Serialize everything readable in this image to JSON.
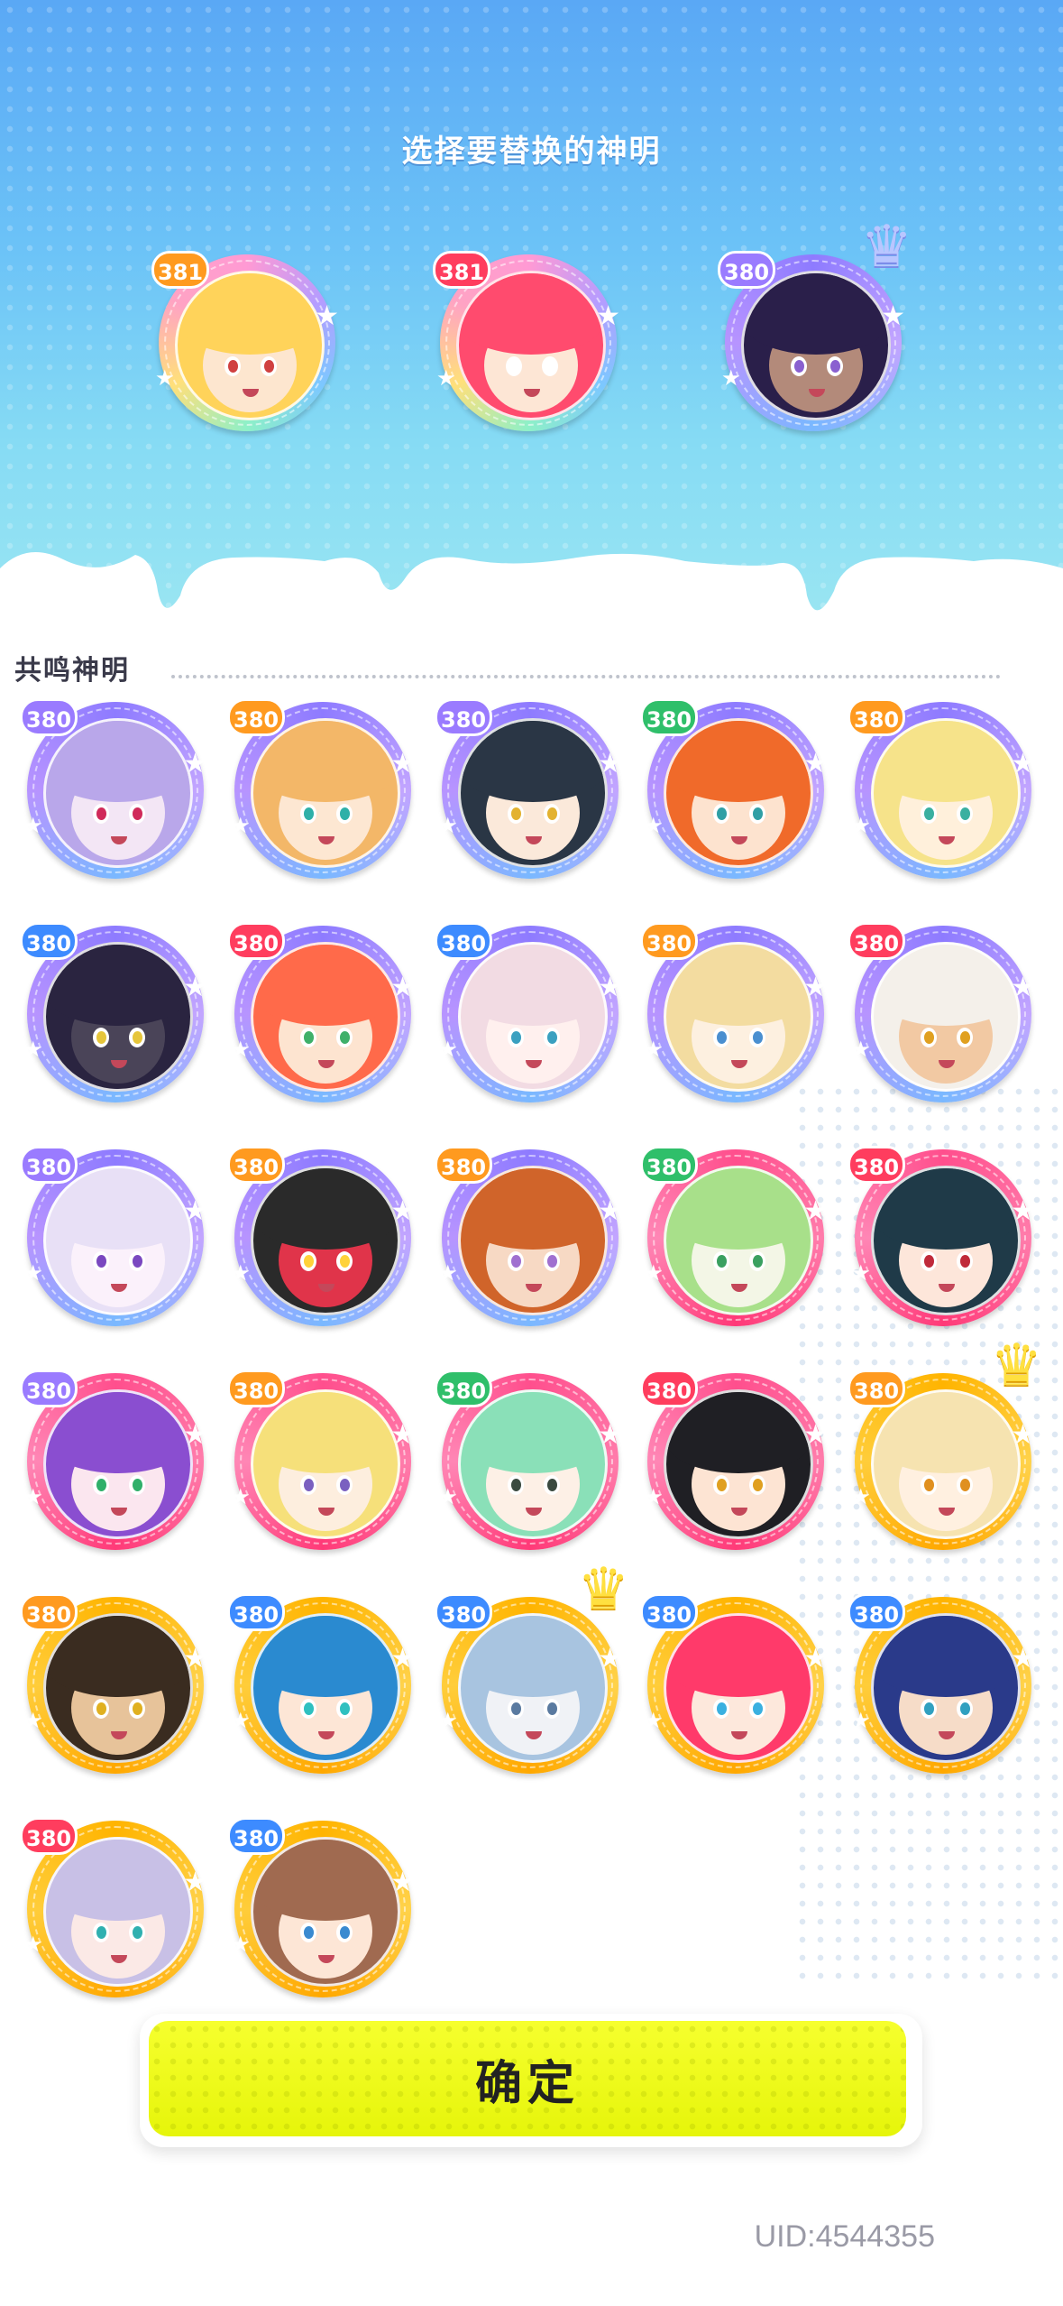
{
  "header": {
    "title": "选择要替换的神明"
  },
  "section": {
    "title": "共鸣神明"
  },
  "selected": [
    {
      "level": "381",
      "tier": "rainbow",
      "lvl_color": "orange",
      "hair": "#ffd35a",
      "skin": "#fde6cf",
      "iris": "#d04040",
      "crown": ""
    },
    {
      "level": "381",
      "tier": "rainbow",
      "lvl_color": "red",
      "hair": "#ff4b6e",
      "skin": "#fde6d5",
      "iris": "#ffffff",
      "crown": ""
    },
    {
      "level": "380",
      "tier": "purple",
      "lvl_color": "purple",
      "hair": "#2a1f4a",
      "skin": "#b38a7a",
      "iris": "#8a60d0",
      "crown": "ice"
    }
  ],
  "gods": [
    {
      "level": "380",
      "tier": "purple",
      "lvl_color": "purple",
      "hair": "#b9a7ea",
      "skin": "#f3e6f5",
      "iris": "#d02a5a",
      "crown": ""
    },
    {
      "level": "380",
      "tier": "purple",
      "lvl_color": "orange",
      "hair": "#f3b768",
      "skin": "#fde7d2",
      "iris": "#2fb0a8",
      "crown": ""
    },
    {
      "level": "380",
      "tier": "purple",
      "lvl_color": "purple",
      "hair": "#2a3645",
      "skin": "#fbe9da",
      "iris": "#e3b230",
      "crown": ""
    },
    {
      "level": "380",
      "tier": "purple",
      "lvl_color": "green",
      "hair": "#f06a2a",
      "skin": "#fde3cf",
      "iris": "#2f9fa5",
      "crown": ""
    },
    {
      "level": "380",
      "tier": "purple",
      "lvl_color": "orange",
      "hair": "#f6e38a",
      "skin": "#fff0db",
      "iris": "#3ab0a0",
      "crown": ""
    },
    {
      "level": "380",
      "tier": "purple",
      "lvl_color": "blue",
      "hair": "#2a2440",
      "skin": "#4a4458",
      "iris": "#e6c53a",
      "crown": ""
    },
    {
      "level": "380",
      "tier": "purple",
      "lvl_color": "red",
      "hair": "#ff6a4a",
      "skin": "#fde4d0",
      "iris": "#3fb06a",
      "crown": ""
    },
    {
      "level": "380",
      "tier": "purple",
      "lvl_color": "blue",
      "hair": "#f2dbe3",
      "skin": "#fff0ee",
      "iris": "#3aa0c0",
      "crown": ""
    },
    {
      "level": "380",
      "tier": "purple",
      "lvl_color": "orange",
      "hair": "#f3dca0",
      "skin": "#fdf0e0",
      "iris": "#4a8fd0",
      "crown": ""
    },
    {
      "level": "380",
      "tier": "purple",
      "lvl_color": "red",
      "hair": "#f4f0ea",
      "skin": "#f2c9a3",
      "iris": "#e0a020",
      "crown": ""
    },
    {
      "level": "380",
      "tier": "purple",
      "lvl_color": "purple",
      "hair": "#e8e0f6",
      "skin": "#fbf1fb",
      "iris": "#7a48c0",
      "crown": ""
    },
    {
      "level": "380",
      "tier": "purple",
      "lvl_color": "orange",
      "hair": "#2a2a2a",
      "skin": "#e0344a",
      "iris": "#ffd23a",
      "crown": ""
    },
    {
      "level": "380",
      "tier": "purple",
      "lvl_color": "orange",
      "hair": "#d0642a",
      "skin": "#f7d9c4",
      "iris": "#a070d0",
      "crown": ""
    },
    {
      "level": "380",
      "tier": "pink",
      "lvl_color": "green",
      "hair": "#a8e08a",
      "skin": "#f3f6e6",
      "iris": "#3aa060",
      "crown": ""
    },
    {
      "level": "380",
      "tier": "pink",
      "lvl_color": "red",
      "hair": "#1f3a48",
      "skin": "#fde6da",
      "iris": "#c02a3a",
      "crown": ""
    },
    {
      "level": "380",
      "tier": "pink",
      "lvl_color": "purple",
      "hair": "#8a4ed0",
      "skin": "#fbe6ef",
      "iris": "#2fb06a",
      "crown": ""
    },
    {
      "level": "380",
      "tier": "pink",
      "lvl_color": "orange",
      "hair": "#f6e07a",
      "skin": "#fdeede",
      "iris": "#7a60c0",
      "crown": ""
    },
    {
      "level": "380",
      "tier": "pink",
      "lvl_color": "green",
      "hair": "#8ae0b8",
      "skin": "#fdf0e6",
      "iris": "#3a4a40",
      "crown": ""
    },
    {
      "level": "380",
      "tier": "pink",
      "lvl_color": "red",
      "hair": "#1f1f24",
      "skin": "#fde4d3",
      "iris": "#e0a020",
      "crown": ""
    },
    {
      "level": "380",
      "tier": "gold",
      "lvl_color": "orange",
      "hair": "#f6e3b0",
      "skin": "#fff0e0",
      "iris": "#e09020",
      "crown": "gold"
    },
    {
      "level": "380",
      "tier": "gold",
      "lvl_color": "orange",
      "hair": "#3a2c20",
      "skin": "#e7c39a",
      "iris": "#e0b020",
      "crown": ""
    },
    {
      "level": "380",
      "tier": "gold",
      "lvl_color": "blue",
      "hair": "#2a8ad0",
      "skin": "#fde6d6",
      "iris": "#2fc0c0",
      "crown": ""
    },
    {
      "level": "380",
      "tier": "gold",
      "lvl_color": "blue",
      "hair": "#a8c4e0",
      "skin": "#f0f2f6",
      "iris": "#5a7aa0",
      "crown": "gold"
    },
    {
      "level": "380",
      "tier": "gold",
      "lvl_color": "blue",
      "hair": "#ff3a6a",
      "skin": "#fde8dc",
      "iris": "#3ab0e0",
      "crown": ""
    },
    {
      "level": "380",
      "tier": "gold",
      "lvl_color": "blue",
      "hair": "#2a3a8a",
      "skin": "#f6dcc8",
      "iris": "#30a0c0",
      "crown": ""
    },
    {
      "level": "380",
      "tier": "gold",
      "lvl_color": "red",
      "hair": "#c8c0e6",
      "skin": "#fbe9e6",
      "iris": "#30b0b0",
      "crown": ""
    },
    {
      "level": "380",
      "tier": "gold",
      "lvl_color": "blue",
      "hair": "#a06a50",
      "skin": "#fde6d6",
      "iris": "#3a8ad0",
      "crown": ""
    }
  ],
  "confirm": {
    "label": "确定"
  },
  "footer": {
    "uid": "UID:4544355"
  }
}
